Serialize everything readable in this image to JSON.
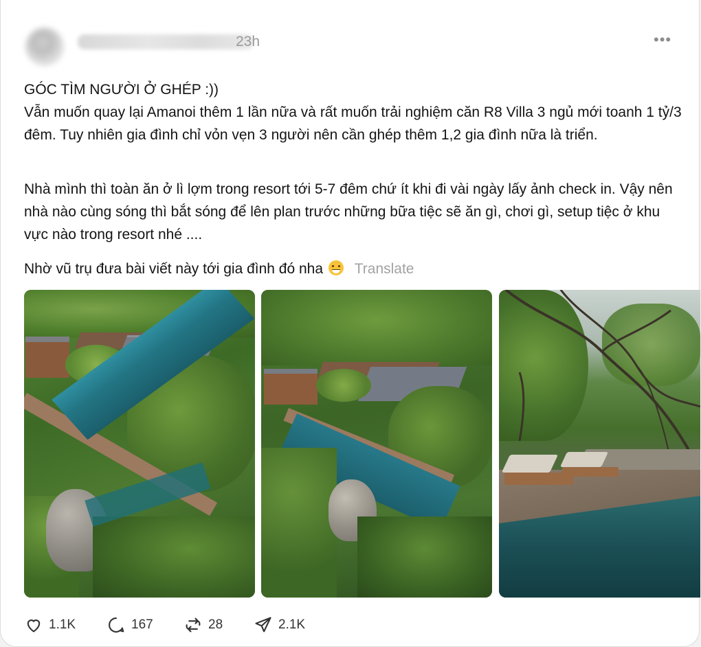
{
  "post": {
    "time": "23h",
    "more_label": "•••",
    "paragraphs": [
      "GÓC TÌM NGƯỜI Ở GHÉP :))\nVẫn muốn quay lại Amanoi thêm 1 lần nữa và rất muốn trải nghiệm căn R8 Villa 3 ngủ mới toanh 1 tỷ/3 đêm. Tuy nhiên gia đình chỉ vỏn vẹn 3 người nên cần ghép thêm 1,2 gia đình nữa là triển.",
      "Nhà mình thì toàn ăn ở lì lợm trong resort tới 5-7 đêm chứ ít khi đi vài ngày lấy ảnh check in. Vậy nên nhà nào cùng sóng thì bắt sóng để lên plan trước những bữa tiệc sẽ ăn gì, chơi gì, setup tiệc ở khu vực nào trong resort nhé ....",
      "Nhờ vũ trụ đưa bài viết này tới gia đình đó nha"
    ],
    "emoji": "grinning-sweat-emoji",
    "translate_label": "Translate"
  },
  "actions": {
    "likes": "1.1K",
    "comments": "167",
    "reposts": "28",
    "shares": "2.1K"
  },
  "colors": {
    "text": "#141414",
    "muted": "#9a9a9a",
    "translate": "#a2a2a2",
    "pool": "#1f6f78",
    "foliage": "#3f6b2a"
  }
}
